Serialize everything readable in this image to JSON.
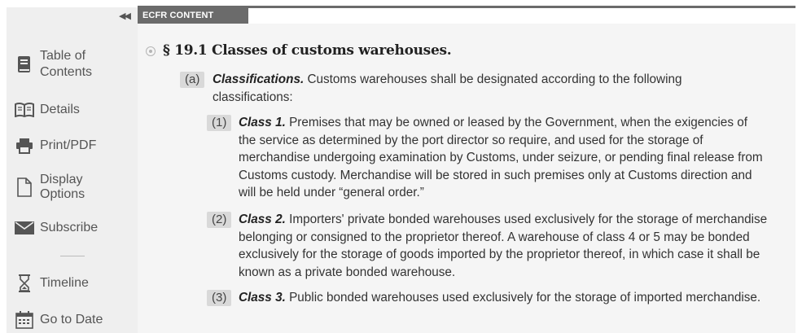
{
  "sidebar": {
    "collapse_glyph": "◀◀",
    "items": [
      {
        "label": "Table of Contents",
        "icon": "book-icon"
      },
      {
        "label": "Details",
        "icon": "open-book-icon"
      },
      {
        "label": "Print/PDF",
        "icon": "printer-icon"
      },
      {
        "label": "Display Options",
        "icon": "document-icon"
      },
      {
        "label": "Subscribe",
        "icon": "envelope-icon"
      },
      {
        "label": "Timeline",
        "icon": "hourglass-icon"
      },
      {
        "label": "Go to Date",
        "icon": "calendar-icon"
      }
    ]
  },
  "tab": {
    "label": "ECFR CONTENT"
  },
  "section": {
    "title": "§ 19.1 Classes of customs warehouses.",
    "paragraphs": [
      {
        "marker": "(a)",
        "heading": "Classifications.",
        "text": "Customs warehouses shall be designated according to the following classifications:"
      },
      {
        "marker": "(1)",
        "heading": "Class 1.",
        "text": "Premises that may be owned or leased by the Government, when the exigencies of the service as determined by the port director so require, and used for the storage of merchandise undergoing examination by Customs, under seizure, or pending final release from Customs custody. Merchandise will be stored in such premises only at Customs direction and will be held under “general order.”"
      },
      {
        "marker": "(2)",
        "heading": "Class 2.",
        "text": "Importers' private bonded warehouses used exclusively for the storage of merchandise belonging or consigned to the proprietor thereof. A warehouse of class 4 or 5 may be bonded exclusively for the storage of goods imported by the proprietor thereof, in which case it shall be known as a private bonded warehouse."
      },
      {
        "marker": "(3)",
        "heading": "Class 3.",
        "text": "Public bonded warehouses used exclusively for the storage of imported merchandise."
      }
    ]
  },
  "colors": {
    "tab_bg": "#6b6b6b",
    "sidebar_bg": "#efefef",
    "content_bg": "#f5f5f5",
    "marker_bg": "#d9d9d9"
  }
}
